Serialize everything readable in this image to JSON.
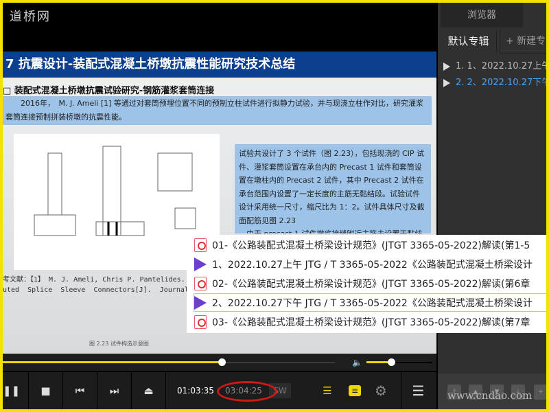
{
  "logo": "道桥网",
  "slide": {
    "title": "7  抗震设计-装配式混凝土桥墩抗震性能研究技术总结",
    "subtitle": "□ 装配式混凝土桥墩抗震试验研究-钢筋灌浆套筒连接",
    "paragraph": "　　2016年，　M. J. Ameli [1] 等通过对套筒预埋位置不同的预制立柱试件进行拟静力试验，并与现浇立柱作对比，研究灌浆套筒连接预制拼装桥墩的抗震性能。",
    "textbox": "试验共设计了 3 个试件（图 2.23），包括现浇的 CIP 试件、灌浆套筒设置在承台内的 Precast 1 试件和套筒设置在墩柱内的 Precast 2 试件，其中 Precast 2 试件在承台范围内设置了一定长度的主筋无黏结段。试验试件设计采用统一尺寸，缩尺比为 1：2。试件具体尺寸及截面配筋见图 2.23\n　由于 precast 1 试件墩底接缝附近主筋未设置无黏结",
    "caption": "图 2.23  试件构造示意图",
    "references": "考文献：【1】 M. J. Ameli, Chris P. Pantelides. S\nuted  Splice  Sleeve  Connectors[J].  Journal  of"
  },
  "playlist_popup": [
    {
      "type": "pdf",
      "label": "01-《公路装配式混凝土桥梁设计规范》(JTGT 3365-05-2022)解读(第1-5"
    },
    {
      "type": "video",
      "label": "1、2022.10.27上午 JTG / T 3365-05-2022《公路装配式混凝土桥梁设计"
    },
    {
      "type": "pdf",
      "label": "02-《公路装配式混凝土桥梁设计规范》(JTGT 3365-05-2022)解读(第6章"
    },
    {
      "type": "video",
      "label": "2、2022.10.27下午 JTG / T 3365-05-2022《公路装配式混凝土桥梁设计",
      "selected": true
    },
    {
      "type": "pdf",
      "label": "03-《公路装配式混凝土桥梁设计规范》(JTGT 3365-05-2022)解读(第7章"
    }
  ],
  "player": {
    "progress_percent": 66,
    "volume_percent": 38,
    "current_time": "01:03:35",
    "total_time": "03:04:25",
    "sw_label": "SW",
    "accent": "#f0d800"
  },
  "right_panel": {
    "header": "浏览器",
    "tabs": [
      "默认专辑",
      "+ 新建专辑"
    ],
    "items": [
      {
        "label": "1. 1、2022.10.27上午",
        "active": false
      },
      {
        "label": "2. 2、2022.10.27下午",
        "active": true,
        "color": "#4aa0f0"
      }
    ]
  },
  "watermark": "www.cndao.com"
}
